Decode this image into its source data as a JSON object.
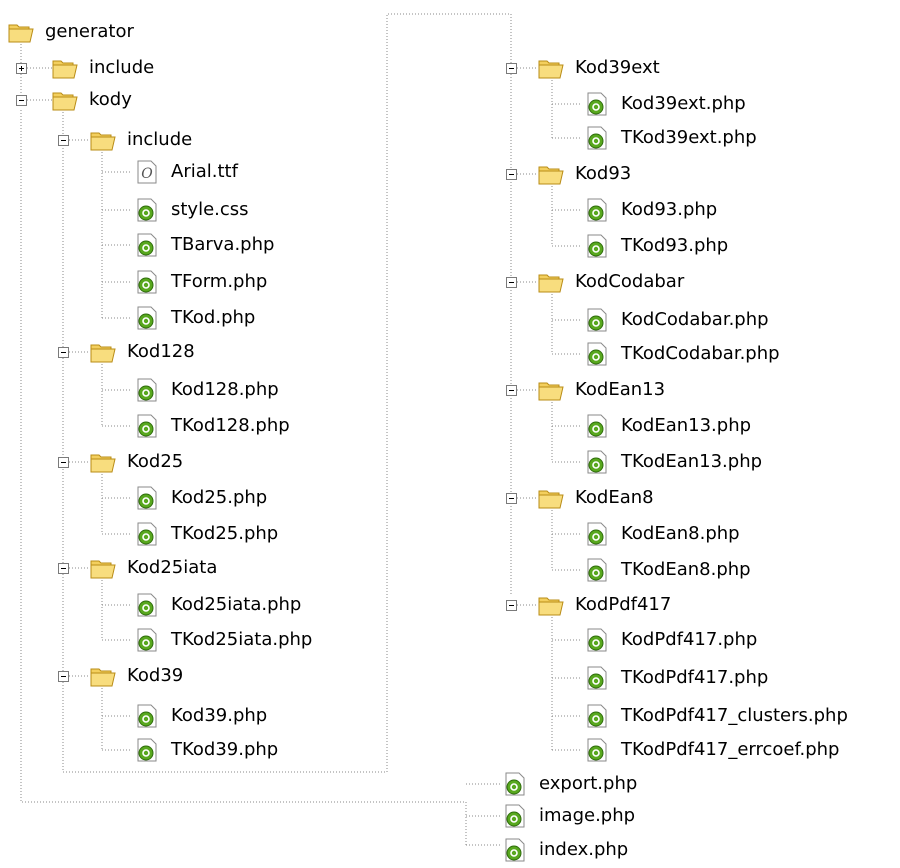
{
  "tree": {
    "root": "generator",
    "include_top": "include",
    "kody": "kody",
    "include": {
      "folder": "include",
      "files": [
        "Arial.ttf",
        "style.css",
        "TBarva.php",
        "TForm.php",
        "TKod.php"
      ]
    },
    "kod128": {
      "folder": "Kod128",
      "files": [
        "Kod128.php",
        "TKod128.php"
      ]
    },
    "kod25": {
      "folder": "Kod25",
      "files": [
        "Kod25.php",
        "TKod25.php"
      ]
    },
    "kod25iata": {
      "folder": "Kod25iata",
      "files": [
        "Kod25iata.php",
        "TKod25iata.php"
      ]
    },
    "kod39": {
      "folder": "Kod39",
      "files": [
        "Kod39.php",
        "TKod39.php"
      ]
    },
    "kod39ext": {
      "folder": "Kod39ext",
      "files": [
        "Kod39ext.php",
        "TKod39ext.php"
      ]
    },
    "kod93": {
      "folder": "Kod93",
      "files": [
        "Kod93.php",
        "TKod93.php"
      ]
    },
    "kodcodabar": {
      "folder": "KodCodabar",
      "files": [
        "KodCodabar.php",
        "TKodCodabar.php"
      ]
    },
    "kodean13": {
      "folder": "KodEan13",
      "files": [
        "KodEan13.php",
        "TKodEan13.php"
      ]
    },
    "kodean8": {
      "folder": "KodEan8",
      "files": [
        "KodEan8.php",
        "TKodEan8.php"
      ]
    },
    "kodpdf417": {
      "folder": "KodPdf417",
      "files": [
        "KodPdf417.php",
        "TKodPdf417.php",
        "TKodPdf417_clusters.php",
        "TKodPdf417_errcoef.php"
      ]
    },
    "root_files": [
      "export.php",
      "image.php",
      "index.php"
    ]
  },
  "icons": {
    "folder": "folder-icon",
    "php_file": "php-file-icon",
    "font_file": "font-file-icon"
  },
  "colors": {
    "folder_fill": "#f6d66b",
    "folder_edge": "#b98c16",
    "php_green": "#58a81e",
    "dotted_line": "#8a8a8a"
  }
}
